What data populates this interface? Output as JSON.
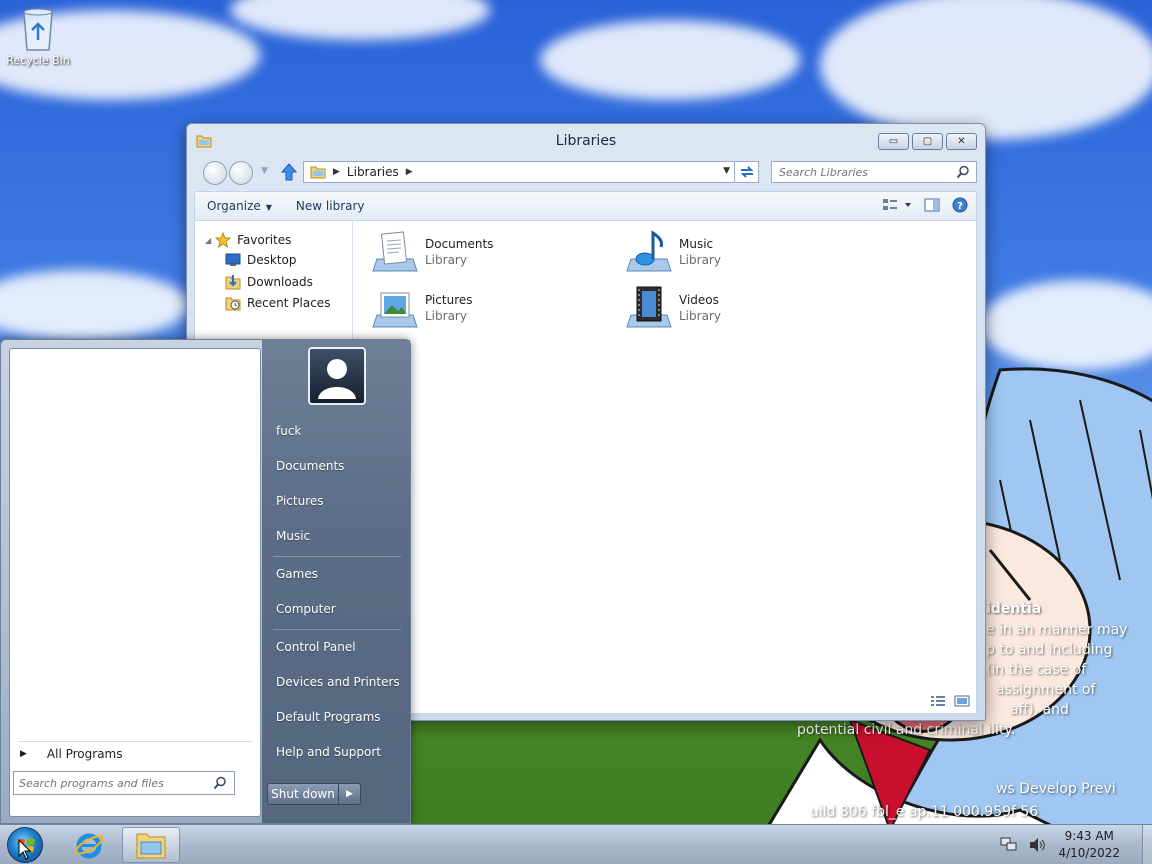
{
  "desktop": {
    "icons": [
      {
        "label": "Recycle Bin",
        "icon": "recycle-bin-icon"
      }
    ],
    "watermark_lines": [
      "identia",
      "e in an  manner may",
      "p to and including",
      "(in the case of",
      "assignment of",
      "aff), and",
      "potential civil and criminal  ility.",
      "ws Develop    Previ",
      "uild 806  fbl_e ap.11   000.959f      56"
    ]
  },
  "explorer": {
    "title": "Libraries",
    "window_buttons": {
      "minimize": "▭",
      "maximize": "▢",
      "close": "✕"
    },
    "address": {
      "breadcrumb": [
        "Libraries"
      ]
    },
    "search": {
      "placeholder": "Search Libraries"
    },
    "toolbar": {
      "organize": "Organize",
      "new_library": "New library"
    },
    "nav_pane": {
      "favorites_label": "Favorites",
      "items": [
        {
          "label": "Desktop",
          "icon": "desktop-icon"
        },
        {
          "label": "Downloads",
          "icon": "downloads-icon"
        },
        {
          "label": "Recent Places",
          "icon": "recent-places-icon"
        }
      ]
    },
    "libraries": [
      {
        "name": "Documents",
        "type": "Library",
        "icon": "documents-library-icon"
      },
      {
        "name": "Music",
        "type": "Library",
        "icon": "music-library-icon"
      },
      {
        "name": "Pictures",
        "type": "Library",
        "icon": "pictures-library-icon"
      },
      {
        "name": "Videos",
        "type": "Library",
        "icon": "videos-library-icon"
      }
    ]
  },
  "start_menu": {
    "all_programs": "All Programs",
    "search_placeholder": "Search programs and files",
    "user_name": "fuck",
    "links": [
      "Documents",
      "Pictures",
      "Music",
      "Games",
      "Computer",
      "Control Panel",
      "Devices and Printers",
      "Default Programs",
      "Help and Support"
    ],
    "shutdown": "Shut down"
  },
  "taskbar": {
    "time": "9:43 AM",
    "date": "4/10/2022"
  },
  "colors": {
    "accent": "#1f7ec9",
    "window_frame": "#cad9ec",
    "start_panel": "#5b6d86"
  }
}
